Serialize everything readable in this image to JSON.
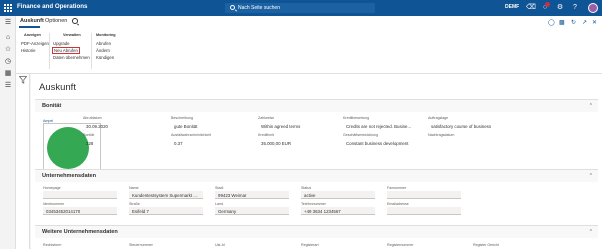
{
  "topbar": {
    "app_title": "Finance and Operations",
    "search_placeholder": "Nach Seite suchen",
    "company": "DEMF"
  },
  "leftnav": {
    "items": [
      "home",
      "favorites",
      "recent",
      "workspaces",
      "modules"
    ]
  },
  "actionpane": {
    "tabs": [
      {
        "label": "Auskunft",
        "active": true
      },
      {
        "label": "Optionen",
        "active": false
      }
    ],
    "groups": [
      {
        "title": "Anzeigen",
        "items": [
          "PDF-Anzeigen",
          "Historie"
        ]
      },
      {
        "title": "Verwalten",
        "items": [
          "Upgrade",
          "Neu Abrufen",
          "Daten übernehmen"
        ]
      },
      {
        "title": "Monitoring",
        "items": [
          "Abrufen",
          "Ändern",
          "Kündigen"
        ]
      }
    ]
  },
  "page": {
    "title": "Auskunft"
  },
  "bonitaet": {
    "title": "Bonität",
    "ampel_label": "Ampel",
    "ampel_color": "#34a853",
    "abrufdatum_label": "Abrufdatum",
    "abrufdatum": "30.09.2020",
    "bonitaet_label": "Bonität",
    "bonitaet_value": "228",
    "beschreibung_label": "Beschreibung",
    "beschreibung": "gute Bonität",
    "ausfallwahrscheinlichkeit_label": "Ausfallwahrscheinlichkeit",
    "ausfallwahrscheinlichkeit": "0.37",
    "zahlweise_label": "Zahlweise",
    "zahlweise": "Within agreed terms",
    "kreditlimit_label": "Kreditlimit",
    "kreditlimit": "35.000,00 EUR",
    "kreditbewertung_label": "Kreditbewertung",
    "kreditbewertung": "Credits are not rejected. Busine...",
    "geschaeftsentwicklung_label": "Geschäftsentwicklung",
    "geschaeftsentwicklung": "Constant business development",
    "auftragslage_label": "Auftragslage",
    "auftragslage": "satisfactory course of business",
    "nachtragsdatum_label": "Nachtragsdatum",
    "nachtragsdatum": ""
  },
  "unternehmensdaten": {
    "title": "Unternehmensdaten",
    "homepage_label": "Homepage",
    "homepage": "",
    "identnummer_label": "Identnummer",
    "identnummer": "03453452014170",
    "name_label": "Name",
    "name": "Kundentestsystem Supermarkt ...",
    "strasse_label": "Straße",
    "strasse": "Esifeld 7",
    "stadt_label": "Stadt",
    "stadt": "99423 Weimar",
    "land_label": "Land",
    "land": "Germany",
    "status_label": "Status",
    "status": "active",
    "telefon_label": "Telefonnummer",
    "telefon": "+49 3634 1234567",
    "fax_label": "Faxnummer",
    "fax": "",
    "email_label": "Emailadresse",
    "email": ""
  },
  "weitere": {
    "title": "Weitere Unternehmensdaten",
    "columns": [
      "Rechtsform",
      "Steuernummer",
      "Ust-Id",
      "Registerart",
      "Registernummer",
      "Register Gericht"
    ]
  }
}
